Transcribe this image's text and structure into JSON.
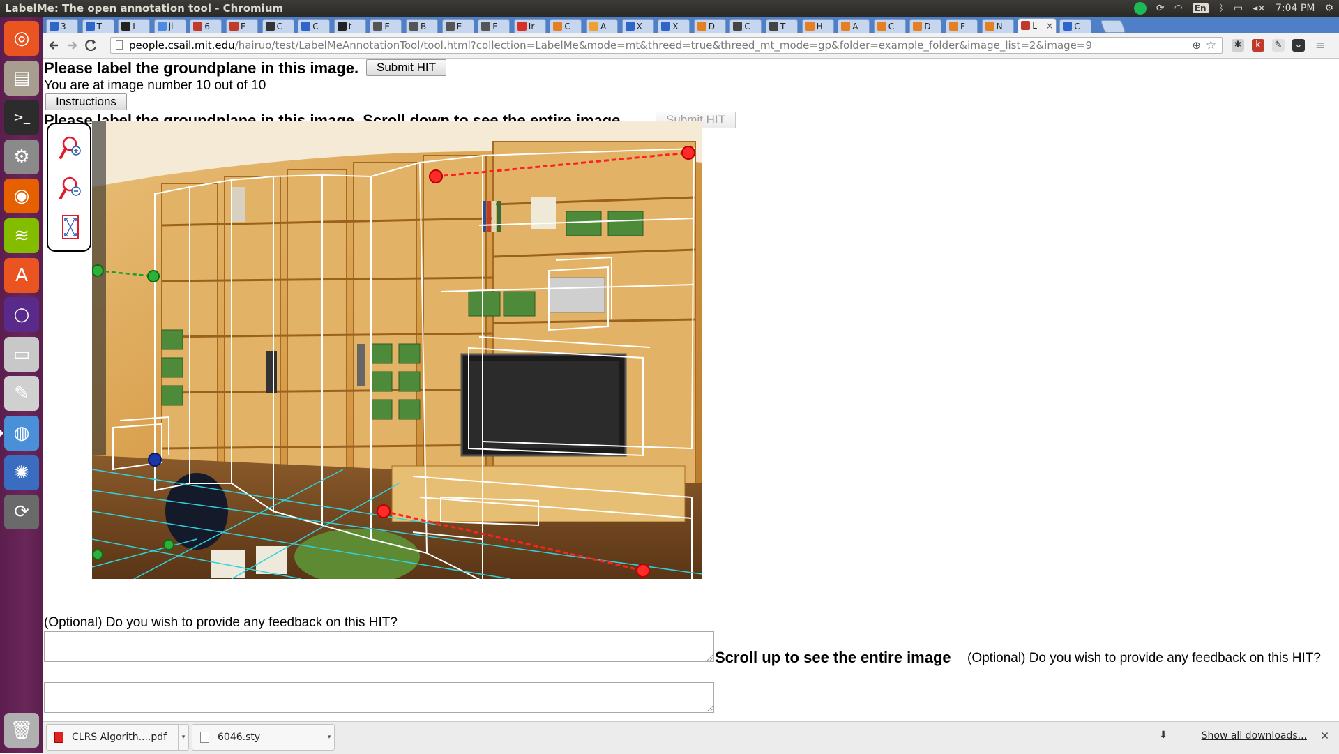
{
  "window": {
    "title": "LabelMe: The open annotation tool - Chromium",
    "clock": "7:04 PM",
    "keyboard_layout": "En"
  },
  "launcher": {
    "items": [
      {
        "name": "ubuntu-dash",
        "icon": "ubuntu-logo-icon",
        "color": "#e95420"
      },
      {
        "name": "files",
        "icon": "files-icon",
        "color": "#a89e8f"
      },
      {
        "name": "terminal",
        "icon": "terminal-icon",
        "color": "#2c2c2c"
      },
      {
        "name": "system-settings",
        "icon": "settings-icon",
        "color": "#8a8a8a"
      },
      {
        "name": "firefox",
        "icon": "firefox-icon",
        "color": "#e66000"
      },
      {
        "name": "spotify",
        "icon": "spotify-icon",
        "color": "#84bd00"
      },
      {
        "name": "software-center",
        "icon": "software-center-icon",
        "color": "#e95420"
      },
      {
        "name": "unity-tweak",
        "icon": "ring-icon",
        "color": "#5a2a8a"
      },
      {
        "name": "disks",
        "icon": "drive-icon",
        "color": "#c8c8c8"
      },
      {
        "name": "drawing",
        "icon": "pen-icon",
        "color": "#d0d0d0"
      },
      {
        "name": "chromium",
        "icon": "chromium-icon",
        "color": "#4a90d9"
      },
      {
        "name": "shotwell",
        "icon": "shotwell-icon",
        "color": "#3a6cc0"
      },
      {
        "name": "software-updater",
        "icon": "updater-icon",
        "color": "#6a6a6a"
      },
      {
        "name": "trash",
        "icon": "trash-icon",
        "color": "#b0b0b0"
      }
    ]
  },
  "tabs": [
    {
      "label": "3",
      "fav": "#2f64c8"
    },
    {
      "label": "T",
      "fav": "#2f64c8"
    },
    {
      "label": "L",
      "fav": "#222222"
    },
    {
      "label": "ji",
      "fav": "#4c8be0"
    },
    {
      "label": "6",
      "fav": "#c0392b"
    },
    {
      "label": "E",
      "fav": "#c0392b"
    },
    {
      "label": "C",
      "fav": "#333333"
    },
    {
      "label": "C",
      "fav": "#2f64c8"
    },
    {
      "label": "t",
      "fav": "#222222"
    },
    {
      "label": "E",
      "fav": "#555555"
    },
    {
      "label": "B",
      "fav": "#555555"
    },
    {
      "label": "E",
      "fav": "#555555"
    },
    {
      "label": "E",
      "fav": "#555555"
    },
    {
      "label": "Ir",
      "fav": "#d93025"
    },
    {
      "label": "C",
      "fav": "#e67e22"
    },
    {
      "label": "A",
      "fav": "#f0a030"
    },
    {
      "label": "X",
      "fav": "#2f64c8"
    },
    {
      "label": "X",
      "fav": "#2f64c8"
    },
    {
      "label": "D",
      "fav": "#e67e22"
    },
    {
      "label": "C",
      "fav": "#444444"
    },
    {
      "label": "T",
      "fav": "#444444"
    },
    {
      "label": "H",
      "fav": "#e67e22"
    },
    {
      "label": "A",
      "fav": "#e67e22"
    },
    {
      "label": "C",
      "fav": "#e67e22"
    },
    {
      "label": "D",
      "fav": "#e67e22"
    },
    {
      "label": "F",
      "fav": "#e67e22"
    },
    {
      "label": "N",
      "fav": "#e67e22"
    },
    {
      "label": "L",
      "fav": "#c0392b",
      "active": true
    },
    {
      "label": "C",
      "fav": "#2f64c8"
    }
  ],
  "toolbar": {
    "url_host": "people.csail.mit.edu",
    "url_path": "/hairuo/test/LabelMeAnnotationTool/tool.html?collection=LabelMe&mode=mt&threed=true&threed_mt_mode=gp&folder=example_folder&image_list=2&image=9"
  },
  "page": {
    "title": "Please label the groundplane in this image.",
    "submit_label": "Submit HIT",
    "image_number_text": "You are at image number 10 out of 10",
    "instructions_label": "Instructions",
    "title2": "Please label the groundplane in this image. Scroll down to see the entire image.",
    "submit2_label": "Submit HIT",
    "feedback_prompt": "(Optional) Do you wish to provide any feedback on this HIT?",
    "scroll_up_msg": "Scroll up to see the entire image",
    "feedback_prompt2": "(Optional) Do you wish to provide any feedback on this HIT?"
  },
  "toolbox": {
    "tools": [
      {
        "name": "zoom-in",
        "icon": "zoom-in-icon"
      },
      {
        "name": "zoom-out",
        "icon": "zoom-out-icon"
      },
      {
        "name": "fit-image",
        "icon": "fit-to-window-icon"
      }
    ]
  },
  "downloads": {
    "items": [
      {
        "label": "CLRS Algorith....pdf",
        "type": "pdf"
      },
      {
        "label": "6046.sty",
        "type": "file"
      }
    ],
    "show_all": "Show all downloads..."
  }
}
